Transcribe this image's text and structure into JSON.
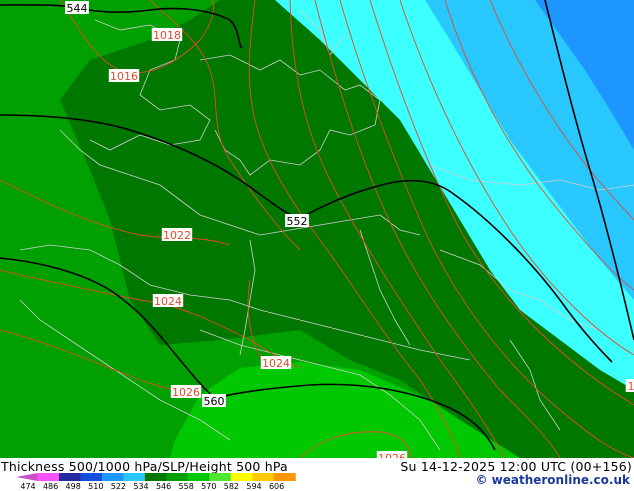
{
  "map": {
    "fills": {
      "bright_green": "#00c800",
      "mid_green": "#00a000",
      "dark_green": "#007800",
      "cyan": "#3cffff",
      "light_blue": "#28c8ff",
      "blue": "#1e96ff",
      "coast_line": "#d0d0d0",
      "slp_line": "#e24a2a",
      "height_line": "#000000",
      "label_box": "#ffffff"
    },
    "slp_labels": [
      "1018",
      "1016",
      "1022",
      "1024",
      "1024",
      "1026",
      "1026",
      "1"
    ],
    "height_labels": [
      "544",
      "552",
      "560"
    ]
  },
  "footer": {
    "title_left": "Thickness 500/1000 hPa/SLP/Height 500 hPa",
    "title_right": "Su 14-12-2025 12:00 UTC (00+156)",
    "credit": "© weatheronline.co.uk",
    "colorbar": {
      "colors": [
        "#c850c8",
        "#ff50ff",
        "#2828a0",
        "#1450dc",
        "#1e96ff",
        "#28c8ff",
        "#007800",
        "#00a000",
        "#00c800",
        "#50e632",
        "#ffff00",
        "#ffc800",
        "#ff9600"
      ],
      "labels": [
        "474",
        "486",
        "498",
        "510",
        "522",
        "534",
        "546",
        "558",
        "570",
        "582",
        "594",
        "606"
      ]
    }
  }
}
